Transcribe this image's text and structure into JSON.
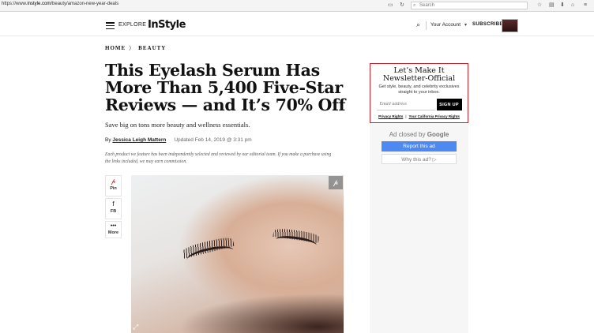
{
  "browser": {
    "url_prefix": "https://www.",
    "url_host": "instyle.com",
    "url_path": "/beauty/amazon-new-year-deals",
    "search_placeholder": "Search"
  },
  "header": {
    "explore_label": "EXPLORE",
    "logo_text": "InStyle",
    "account_label": "Your Account",
    "subscribe_label": "SUBSCRIBE"
  },
  "breadcrumb": {
    "home": "HOME",
    "section": "BEAUTY"
  },
  "article": {
    "title": "This Eyelash Serum Has More Than 5,400 Five-Star Reviews — and It’s 70% Off",
    "dek": "Save big on tons more beauty and wellness essentials.",
    "byline_prefix": "By ",
    "author": "Jessica Leigh Mattern",
    "updated": "Updated Feb 14, 2019 @ 3:31 pm",
    "disclaimer": "Each product we feature has been independently selected and reviewed by our editorial team. If you make a purchase using the links included, we may earn commission."
  },
  "share": {
    "pin_label": "Pin",
    "fb_label": "FB",
    "more_label": "More"
  },
  "newsletter": {
    "title_line1": "Let’s Make It",
    "title_line2": "Newsletter-Official",
    "subtitle": "Get style, beauty, and celebrity exclusives straight to your inbox.",
    "email_placeholder": "Email address",
    "signup_label": "SIGN UP",
    "privacy_link": "Privacy Rights",
    "ca_privacy_link": "Your California Privacy Rights"
  },
  "ad": {
    "closed_prefix": "Ad closed by ",
    "closed_brand": "Google",
    "report_label": "Report this ad",
    "why_label": "Why this ad? ▷"
  },
  "colors": {
    "accent_red": "#c8232c",
    "google_blue": "#4d89f0"
  }
}
